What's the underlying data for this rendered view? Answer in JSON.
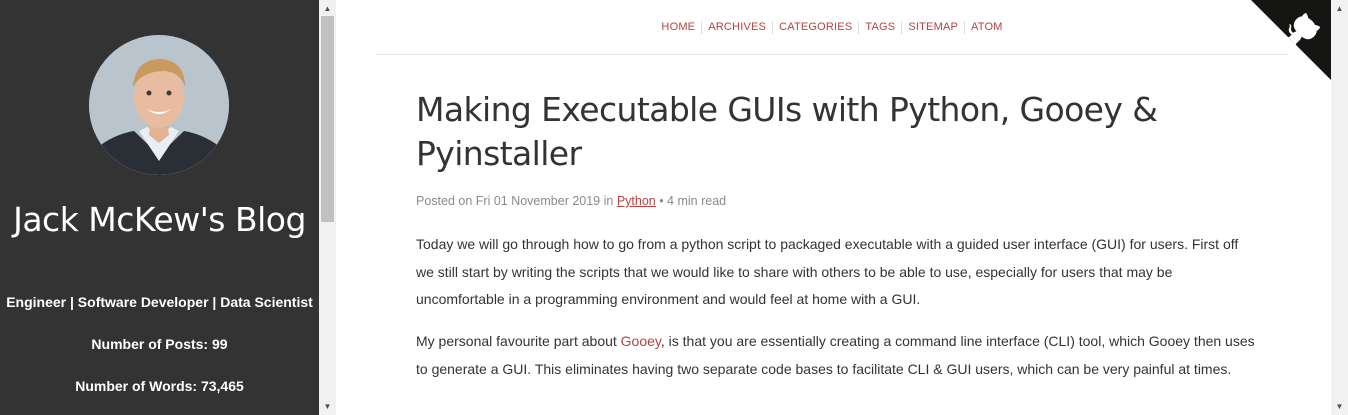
{
  "sidebar": {
    "title": "Jack McKew's Blog",
    "subtitle": "Engineer | Software Developer | Data Scientist",
    "posts_stat": "Number of Posts: 99",
    "words_stat": "Number of Words: 73,465"
  },
  "nav": {
    "items": [
      "HOME",
      "ARCHIVES",
      "CATEGORIES",
      "TAGS",
      "SITEMAP",
      "ATOM"
    ]
  },
  "post": {
    "title": "Making Executable GUIs with Python, Gooey & Pyinstaller",
    "meta_prefix": "Posted on Fri 01 November 2019 in ",
    "category": "Python",
    "meta_suffix": " • 4 min read",
    "p1": "Today we will go through how to go from a python script to packaged executable with a guided user interface (GUI) for users. First off we still start by writing the scripts that we would like to share with others to be able to use, especially for users that may be uncomfortable in a programming environment and would feel at home with a GUI.",
    "p2_before": "My personal favourite part about ",
    "p2_link": "Gooey",
    "p2_after": ", is that you are essentially creating a command line interface (CLI) tool, which Gooey then uses to generate a GUI. This eliminates having two separate code bases to facilitate CLI & GUI users, which can be very painful at times."
  },
  "colors": {
    "sidebar_bg": "#333333",
    "accent": "#b84040",
    "text": "#333333",
    "meta": "#8a8a8a"
  },
  "icons": {
    "github_corner": "github-octocat-icon"
  }
}
